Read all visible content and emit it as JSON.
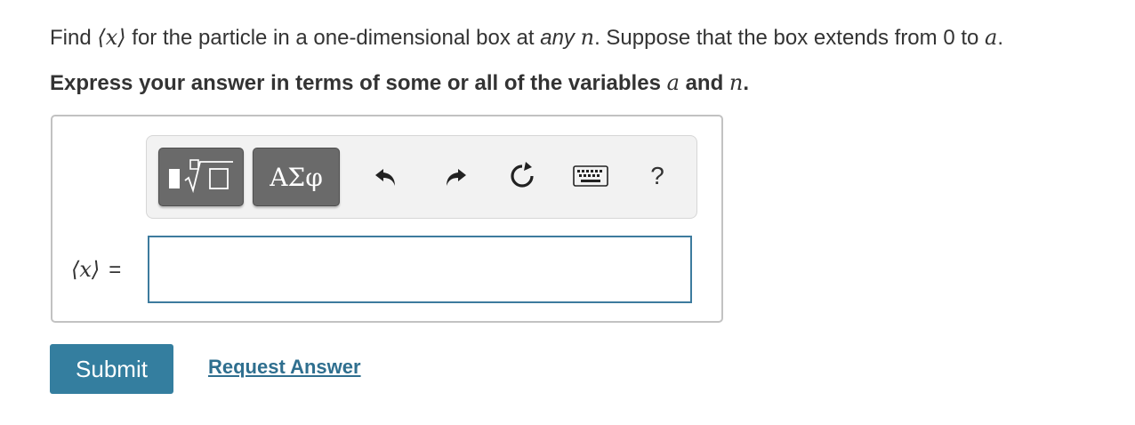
{
  "question": {
    "prefix": "Find ",
    "expectation": "⟨x⟩",
    "middle": " for the particle in a one-dimensional box at ",
    "emphasis": "any",
    "variable_n": "n",
    "suffix": ". Suppose that the box extends from 0 to ",
    "variable_a": "a",
    "end": "."
  },
  "instruction": {
    "prefix": "Express your answer in terms of some or all of the variables ",
    "var1": "a",
    "conjunction": " and ",
    "var2": "n",
    "end": "."
  },
  "toolbar": {
    "symbols_label": "ΑΣφ",
    "help_label": "?",
    "icons": [
      "templates-icon",
      "undo-icon",
      "redo-icon",
      "reset-icon",
      "keyboard-icon",
      "help-icon"
    ]
  },
  "answer": {
    "label": "⟨x⟩",
    "equals": "=",
    "value": ""
  },
  "actions": {
    "submit_label": "Submit",
    "request_label": "Request Answer"
  },
  "colors": {
    "submit_bg": "#347e9f",
    "link": "#2f6f8f",
    "input_border": "#3d7b9e",
    "toolbar_button": "#6a6a6a"
  }
}
